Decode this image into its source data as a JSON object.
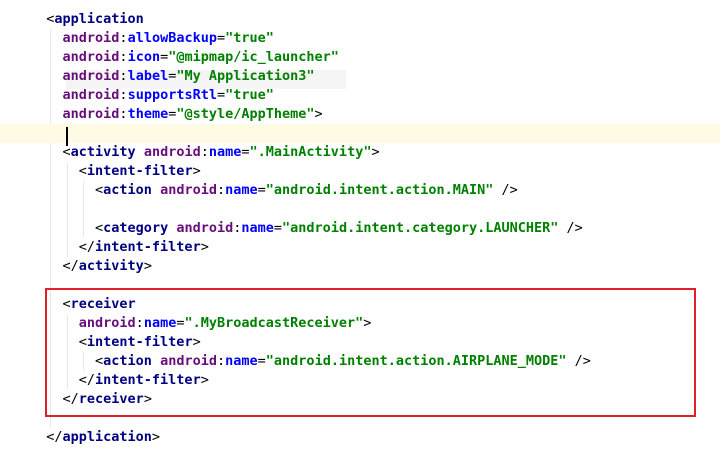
{
  "editor": {
    "language": "xml",
    "highlight_box_color": "#e0202a",
    "lines": [
      {
        "indent": 2,
        "tokens": [
          [
            "pun",
            "<"
          ],
          [
            "tag",
            "application"
          ]
        ]
      },
      {
        "indent": 4,
        "tokens": [
          [
            "ns",
            "android"
          ],
          [
            "pun",
            ":"
          ],
          [
            "attr",
            "allowBackup"
          ],
          [
            "pun",
            "="
          ],
          [
            "val",
            "\"true\""
          ]
        ]
      },
      {
        "indent": 4,
        "tokens": [
          [
            "ns",
            "android"
          ],
          [
            "pun",
            ":"
          ],
          [
            "attr",
            "icon"
          ],
          [
            "pun",
            "="
          ],
          [
            "val",
            "\"@mipmap/ic_launcher\""
          ]
        ]
      },
      {
        "indent": 4,
        "tokens": [
          [
            "ns",
            "android"
          ],
          [
            "pun",
            ":"
          ],
          [
            "attr",
            "label"
          ],
          [
            "pun",
            "="
          ],
          [
            "val",
            "\"My Application3\""
          ]
        ]
      },
      {
        "indent": 4,
        "tokens": [
          [
            "ns",
            "android"
          ],
          [
            "pun",
            ":"
          ],
          [
            "attr",
            "supportsRtl"
          ],
          [
            "pun",
            "="
          ],
          [
            "val",
            "\"true\""
          ]
        ]
      },
      {
        "indent": 4,
        "tokens": [
          [
            "ns",
            "android"
          ],
          [
            "pun",
            ":"
          ],
          [
            "attr",
            "theme"
          ],
          [
            "pun",
            "="
          ],
          [
            "val",
            "\"@style/AppTheme\""
          ],
          [
            "pun",
            ">"
          ]
        ]
      },
      {
        "indent": 0,
        "tokens": [],
        "current": true
      },
      {
        "indent": 4,
        "tokens": [
          [
            "pun",
            "<"
          ],
          [
            "tag",
            "activity"
          ],
          [
            "pun",
            " "
          ],
          [
            "ns",
            "android"
          ],
          [
            "pun",
            ":"
          ],
          [
            "attr",
            "name"
          ],
          [
            "pun",
            "="
          ],
          [
            "val",
            "\".MainActivity\""
          ],
          [
            "pun",
            ">"
          ]
        ]
      },
      {
        "indent": 6,
        "tokens": [
          [
            "pun",
            "<"
          ],
          [
            "tag",
            "intent-filter"
          ],
          [
            "pun",
            ">"
          ]
        ]
      },
      {
        "indent": 8,
        "tokens": [
          [
            "pun",
            "<"
          ],
          [
            "tag",
            "action"
          ],
          [
            "pun",
            " "
          ],
          [
            "ns",
            "android"
          ],
          [
            "pun",
            ":"
          ],
          [
            "attr",
            "name"
          ],
          [
            "pun",
            "="
          ],
          [
            "val",
            "\"android.intent.action.MAIN\""
          ],
          [
            "pun",
            " />"
          ]
        ]
      },
      {
        "indent": 0,
        "tokens": []
      },
      {
        "indent": 8,
        "tokens": [
          [
            "pun",
            "<"
          ],
          [
            "tag",
            "category"
          ],
          [
            "pun",
            " "
          ],
          [
            "ns",
            "android"
          ],
          [
            "pun",
            ":"
          ],
          [
            "attr",
            "name"
          ],
          [
            "pun",
            "="
          ],
          [
            "val",
            "\"android.intent.category.LAUNCHER\""
          ],
          [
            "pun",
            " />"
          ]
        ]
      },
      {
        "indent": 6,
        "tokens": [
          [
            "pun",
            "</"
          ],
          [
            "tag",
            "intent-filter"
          ],
          [
            "pun",
            ">"
          ]
        ]
      },
      {
        "indent": 4,
        "tokens": [
          [
            "pun",
            "</"
          ],
          [
            "tag",
            "activity"
          ],
          [
            "pun",
            ">"
          ]
        ]
      },
      {
        "indent": 0,
        "tokens": []
      },
      {
        "indent": 4,
        "tokens": [
          [
            "pun",
            "<"
          ],
          [
            "tag",
            "receiver"
          ]
        ]
      },
      {
        "indent": 6,
        "tokens": [
          [
            "ns",
            "android"
          ],
          [
            "pun",
            ":"
          ],
          [
            "attr",
            "name"
          ],
          [
            "pun",
            "="
          ],
          [
            "val",
            "\".MyBroadcastReceiver\""
          ],
          [
            "pun",
            ">"
          ]
        ]
      },
      {
        "indent": 6,
        "tokens": [
          [
            "pun",
            "<"
          ],
          [
            "tag",
            "intent-filter"
          ],
          [
            "pun",
            ">"
          ]
        ]
      },
      {
        "indent": 8,
        "tokens": [
          [
            "pun",
            "<"
          ],
          [
            "tag",
            "action"
          ],
          [
            "pun",
            " "
          ],
          [
            "ns",
            "android"
          ],
          [
            "pun",
            ":"
          ],
          [
            "attr",
            "name"
          ],
          [
            "pun",
            "="
          ],
          [
            "val",
            "\"android.intent.action.AIRPLANE_MODE\""
          ],
          [
            "pun",
            " />"
          ]
        ]
      },
      {
        "indent": 6,
        "tokens": [
          [
            "pun",
            "</"
          ],
          [
            "tag",
            "intent-filter"
          ],
          [
            "pun",
            ">"
          ]
        ]
      },
      {
        "indent": 4,
        "tokens": [
          [
            "pun",
            "</"
          ],
          [
            "tag",
            "receiver"
          ],
          [
            "pun",
            ">"
          ]
        ]
      },
      {
        "indent": 0,
        "tokens": []
      },
      {
        "indent": 2,
        "tokens": [
          [
            "pun",
            "</"
          ],
          [
            "tag",
            "application"
          ],
          [
            "pun",
            ">"
          ]
        ]
      }
    ]
  }
}
